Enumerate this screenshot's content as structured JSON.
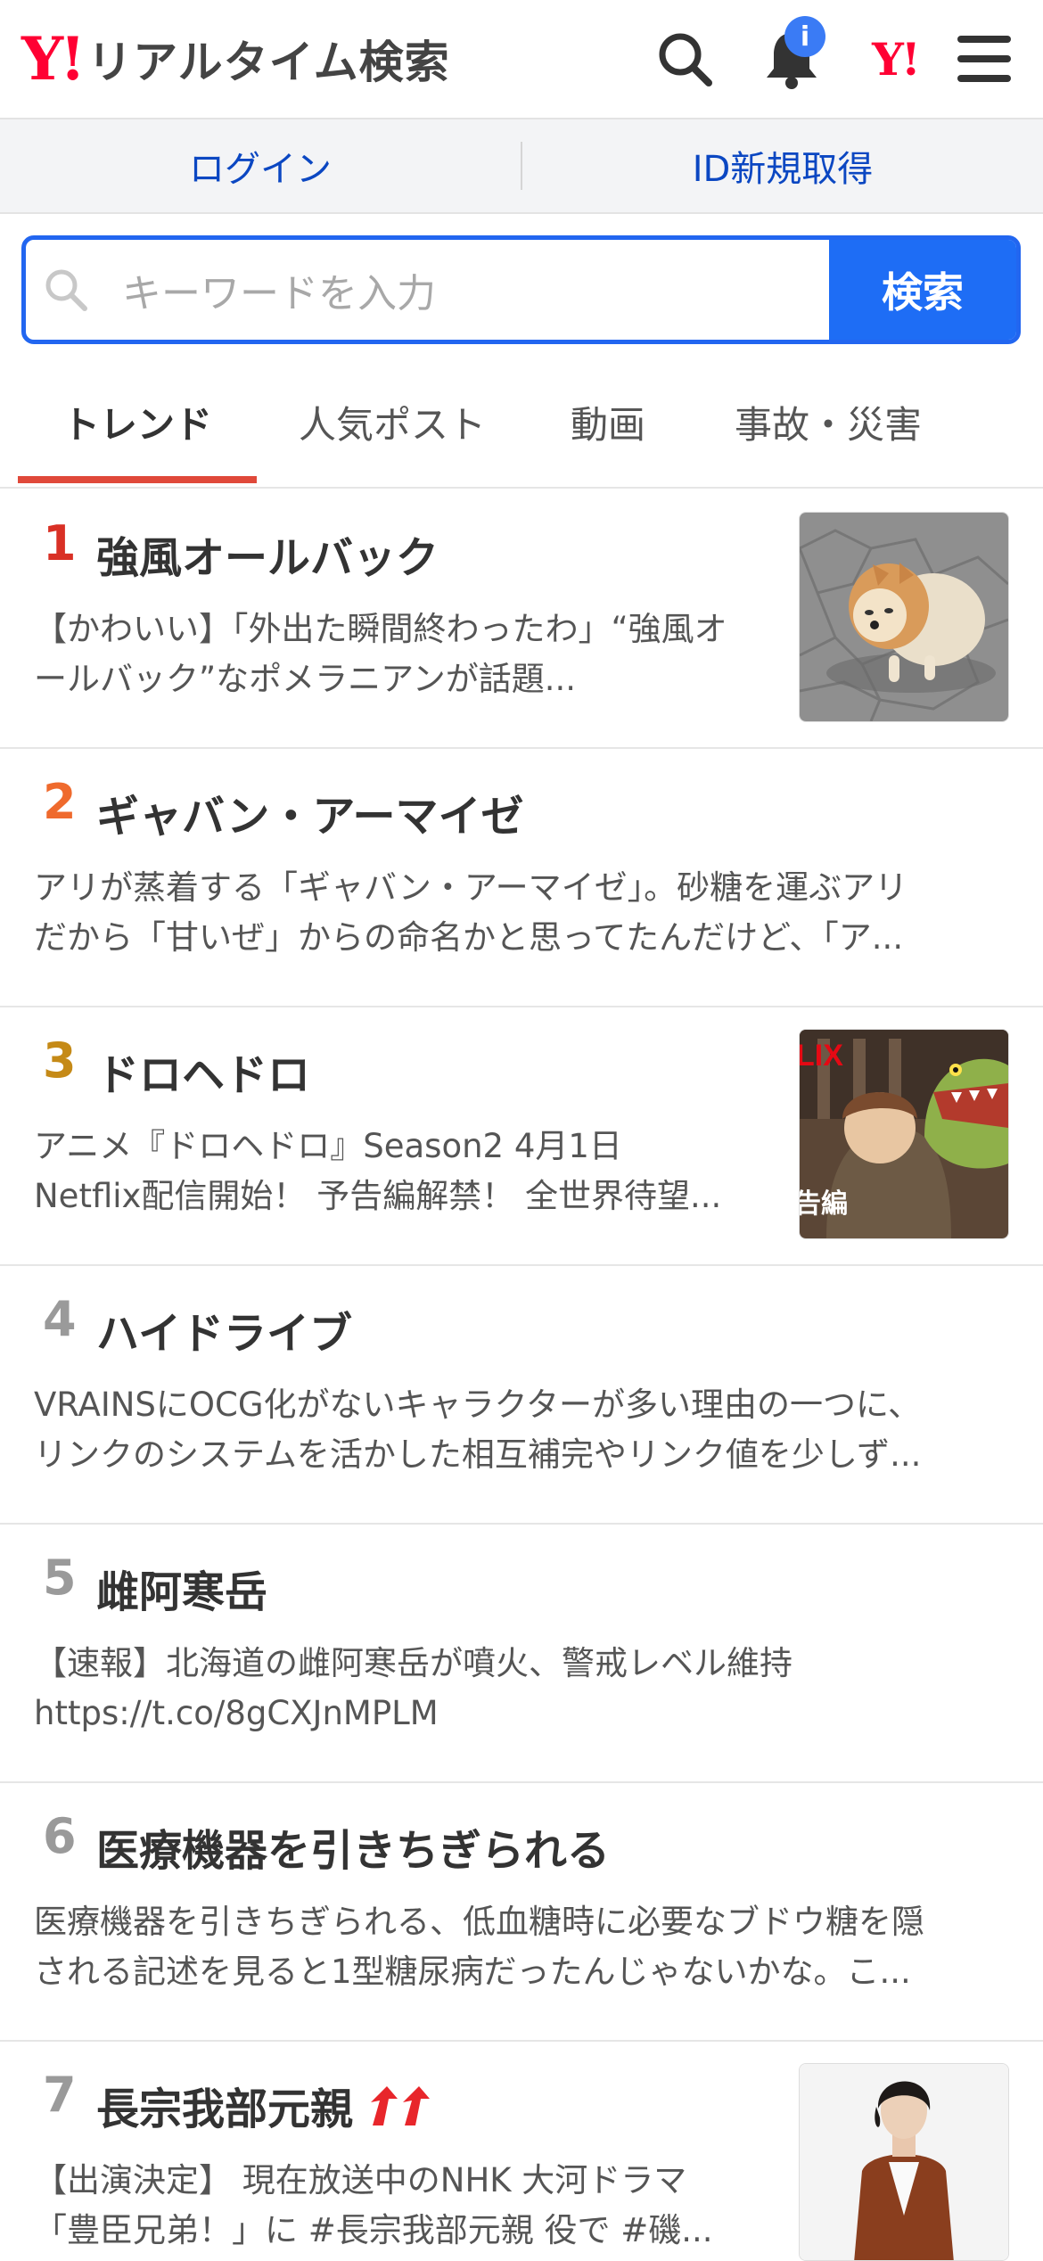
{
  "header": {
    "logo_mark": "Y!",
    "logo_text": "リアルタイム検索",
    "notification_count": "i",
    "yahoo_icon_text": "Y!"
  },
  "login_bar": {
    "login_label": "ログイン",
    "register_label": "ID新規取得"
  },
  "search": {
    "placeholder": "キーワードを入力",
    "button_label": "検索"
  },
  "tabs": [
    {
      "label": "トレンド",
      "active": true
    },
    {
      "label": "人気ポスト",
      "active": false
    },
    {
      "label": "動画",
      "active": false
    },
    {
      "label": "事故・災害",
      "active": false
    }
  ],
  "colors": {
    "accent_blue": "#1e6df5",
    "brand_red": "#ff0033",
    "rank1": "#d93025",
    "rank2": "#ef6a2d",
    "rank3": "#c58a17",
    "rank_other": "#9a9a9a",
    "tab_indicator": "#e0493a"
  },
  "trends": [
    {
      "rank": "1",
      "title": "強風オールバック",
      "desc": [
        "【かわいい】「外出た瞬間終わったわ」“強風オ",
        "ールバック”なポメラニアンが話題..."
      ],
      "thumb": "pomeranian-photo"
    },
    {
      "rank": "2",
      "title": "ギャバン・アーマイゼ",
      "desc": [
        "アリが蒸着する「ギャバン・アーマイゼ」。砂糖を運ぶアリ",
        "だから「甘いぜ」からの命名かと思ってたんだけど、「ア..."
      ]
    },
    {
      "rank": "3",
      "title": "ドロヘドロ",
      "desc": [
        "アニメ『ドロヘドロ』Season2 4月1日",
        "Netflix配信開始！ 予告編解禁！ 全世界待望..."
      ],
      "thumb": "anime-still",
      "thumb_text": [
        "LIX",
        "告編"
      ]
    },
    {
      "rank": "4",
      "title": "ハイドライブ",
      "desc": [
        "VRAINSにOCG化がないキャラクターが多い理由の一つに、",
        "リンクのシステムを活かした相互補完やリンク値を少しず..."
      ]
    },
    {
      "rank": "5",
      "title": "雌阿寒岳",
      "desc": [
        "【速報】北海道の雌阿寒岳が噴火、警戒レベル維持",
        "https://t.co/8gCXJnMPLM"
      ]
    },
    {
      "rank": "6",
      "title": "医療機器を引きちぎられる",
      "desc": [
        "医療機器を引きちぎられる、低血糖時に必要なブドウ糖を隠",
        "される記述を見ると1型糖尿病だったんじゃないかな。こ..."
      ]
    },
    {
      "rank": "7",
      "title": "長宗我部元親",
      "rising": true,
      "desc": [
        "【出演決定】 現在放送中のNHK 大河ドラマ",
        "「豊臣兄弟！」に #長宗我部元親 役で #磯..."
      ],
      "thumb": "actor-photo"
    }
  ]
}
